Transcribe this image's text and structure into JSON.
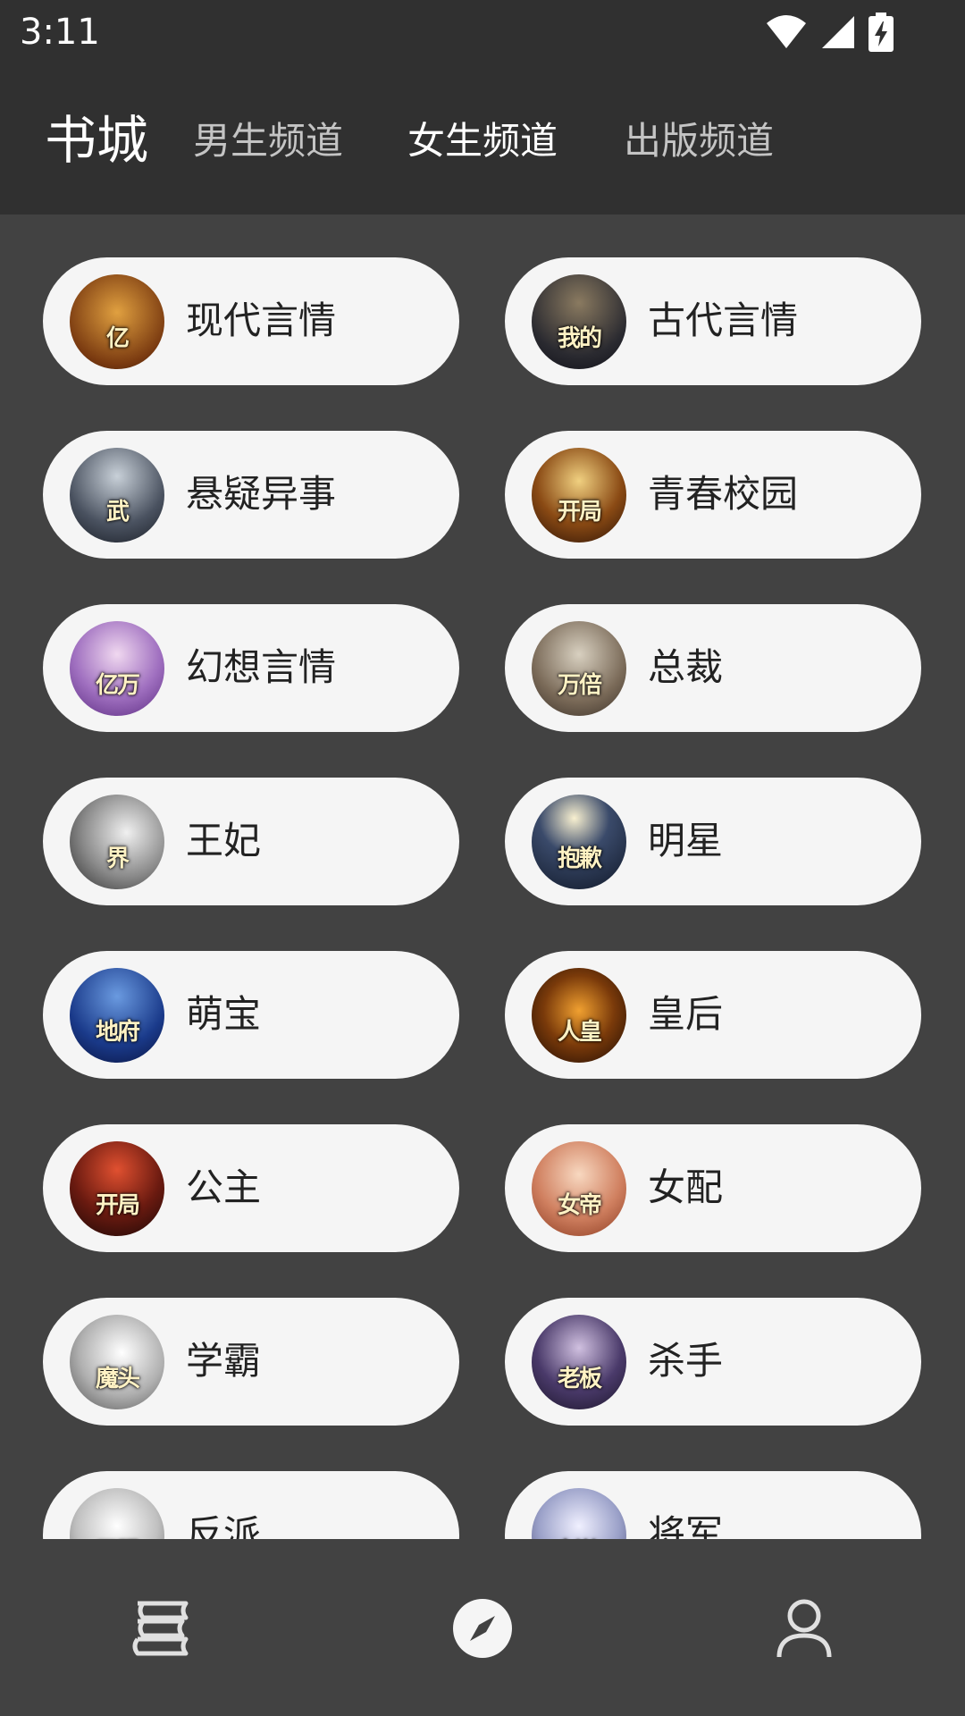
{
  "status": {
    "time": "3:11"
  },
  "header": {
    "title": "书城",
    "tabs": [
      "男生频道",
      "女生频道",
      "出版频道"
    ]
  },
  "categories": [
    "现代言情",
    "古代言情",
    "悬疑异事",
    "青春校园",
    "幻想言情",
    "总裁",
    "王妃",
    "明星",
    "萌宝",
    "皇后",
    "公主",
    "女配",
    "学霸",
    "杀手",
    "反派",
    "将军"
  ],
  "bottom_nav": {
    "items": [
      "bookshelf-icon",
      "discover-compass-icon",
      "profile-icon"
    ]
  },
  "colors": {
    "background": "#424242",
    "header_bg": "#303030",
    "card_bg": "#f5f5f5",
    "tab_active": "#ffffff",
    "tab_inactive": "#c4c4c4"
  }
}
